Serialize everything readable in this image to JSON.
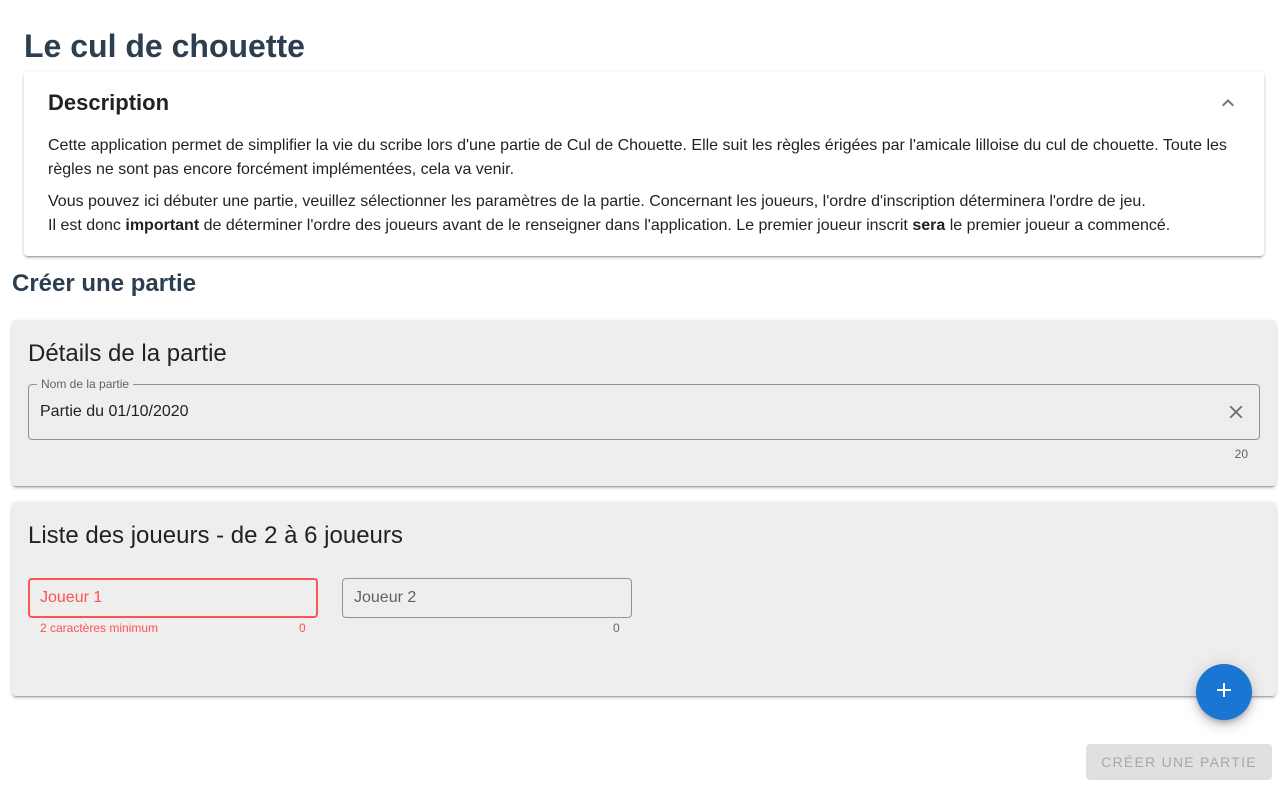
{
  "app": {
    "title": "Le cul de chouette"
  },
  "description": {
    "header": "Description",
    "paragraph1": "Cette application permet de simplifier la vie du scribe lors d'une partie de Cul de Chouette. Elle suit les règles érigées par l'amicale lilloise du cul de chouette. Toute les règles ne sont pas encore forcément implémentées, cela va venir.",
    "paragraph2_line1": "Vous pouvez ici débuter une partie, veuillez sélectionner les paramètres de la partie. Concernant les joueurs, l'ordre d'inscription déterminera l'ordre de jeu.",
    "paragraph2_line2": {
      "part1": "Il est donc ",
      "bold1": "important",
      "part2": " de déterminer l'ordre des joueurs avant de le renseigner dans l'application. Le premier joueur inscrit ",
      "bold2": "sera",
      "part3": " le premier joueur a commencé."
    }
  },
  "section": {
    "title": "Créer une partie"
  },
  "details": {
    "title": "Détails de la partie",
    "name_field": {
      "label": "Nom de la partie",
      "value": "Partie du 01/10/2020",
      "counter": "20"
    }
  },
  "players": {
    "title": "Liste des joueurs - de 2 à 6 joueurs",
    "fields": [
      {
        "placeholder": "Joueur 1",
        "value": "",
        "counter": "0",
        "error": "2 caractères minimum"
      },
      {
        "placeholder": "Joueur 2",
        "value": "",
        "counter": "0",
        "error": ""
      }
    ]
  },
  "actions": {
    "create_label": "Créer une partie"
  },
  "colors": {
    "primary": "#1976d2",
    "error": "#ff5252",
    "heading": "#2c3e50",
    "card_bg": "#eeeeee"
  },
  "icons": {
    "collapse": "chevron-up-icon",
    "clear": "close-icon",
    "add": "plus-icon"
  }
}
